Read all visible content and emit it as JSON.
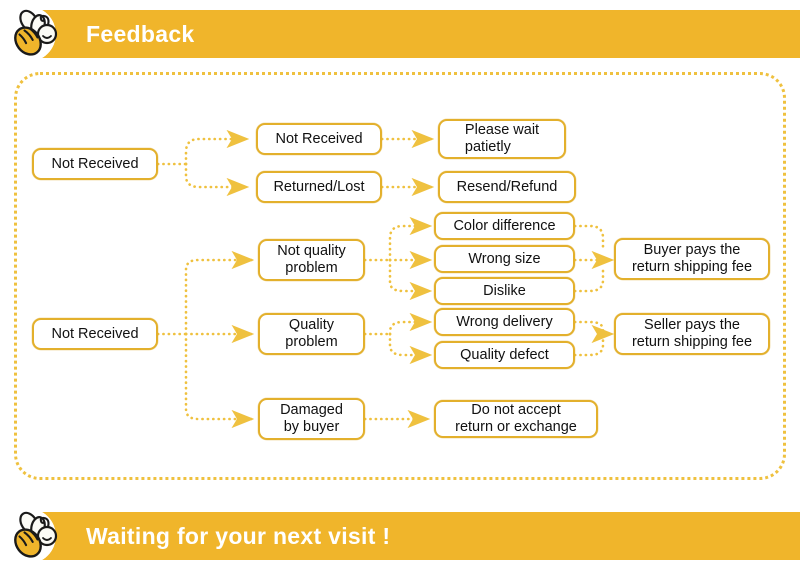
{
  "header": {
    "title": "Feedback",
    "icon": "bee-icon",
    "watermark": "",
    "bar_color": "#F0B52B",
    "text_color": "#FFFFFF"
  },
  "footer": {
    "title": "Waiting for your next visit !",
    "icon": "bee-icon",
    "bar_color": "#F0B52B",
    "text_color": "#FFFFFF"
  },
  "flowchart": {
    "border_color": "#EFC13F",
    "node_border_color": "#E3B02C",
    "node_fill": "#FFFFFF",
    "connector_color": "#EFC13F",
    "nodes": {
      "root_top": "Not Received",
      "not_received_2": "Not Received",
      "returned_lost": "Returned/Lost",
      "please_wait": "Please wait\npatietly",
      "resend_refund": "Resend/Refund",
      "root_bottom": "Not Received",
      "not_quality_problem": "Not quality\nproblem",
      "quality_problem": "Quality\nproblem",
      "damaged_by_buyer": "Damaged\nby buyer",
      "color_difference": "Color difference",
      "wrong_size": "Wrong size",
      "dislike": "Dislike",
      "wrong_delivery": "Wrong delivery",
      "quality_defect": "Quality defect",
      "buyer_pays": "Buyer pays the\nreturn shipping fee",
      "seller_pays": "Seller pays the\nreturn shipping fee",
      "do_not_accept": "Do not accept\nreturn or exchange"
    }
  }
}
